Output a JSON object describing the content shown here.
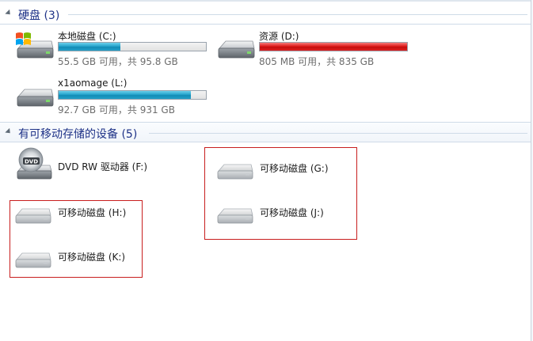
{
  "hard_disks": {
    "title": "硬盘 (3)",
    "drives": [
      {
        "name": "本地磁盘 (C:)",
        "size_text": "55.5 GB 可用，共 95.8 GB",
        "used_fraction": 0.42,
        "bar_color": "#1a95c0"
      },
      {
        "name": "资源 (D:)",
        "size_text": "805 MB 可用，共 835 GB",
        "used_fraction": 0.999,
        "bar_color": "#d81818"
      },
      {
        "name": "x1aomage (L:)",
        "size_text": "92.7 GB 可用，共 931 GB",
        "used_fraction": 0.9,
        "bar_color": "#1a95c0"
      }
    ]
  },
  "removable": {
    "title": "有可移动存储的设备 (5)",
    "dvd": {
      "name": "DVD RW 驱动器 (F:)",
      "badge": "DVD"
    },
    "drives": [
      {
        "name": "可移动磁盘 (G:)"
      },
      {
        "name": "可移动磁盘 (J:)"
      },
      {
        "name": "可移动磁盘 (H:)"
      },
      {
        "name": "可移动磁盘 (K:)"
      }
    ]
  },
  "colors": {
    "group_title": "#1e3287",
    "selection_box": "#c81e1e"
  }
}
